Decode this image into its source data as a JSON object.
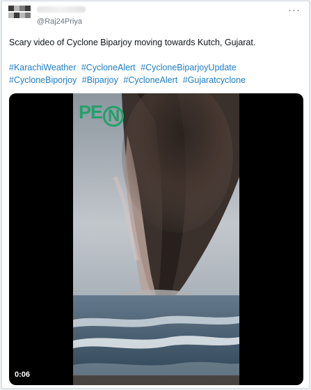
{
  "tweet": {
    "handle": "@Raj24Priya",
    "more_label": "···",
    "text": "Scary video of Cyclone Biparjoy moving towards Kutch, Gujarat.",
    "hashtags": [
      "#KarachiWeather",
      "#CycloneAlert",
      "#CycloneBiparjoyUpdate",
      "#CycloneBiporjoy",
      "#Biparjoy",
      "#CycloneAlert",
      "#Gujaratcyclone"
    ]
  },
  "video": {
    "watermark_left": "PE",
    "watermark_ring": "N",
    "timestamp": "0:06"
  },
  "colors": {
    "hashtag": "#1d7ec5",
    "watermark": "#22a06b"
  }
}
